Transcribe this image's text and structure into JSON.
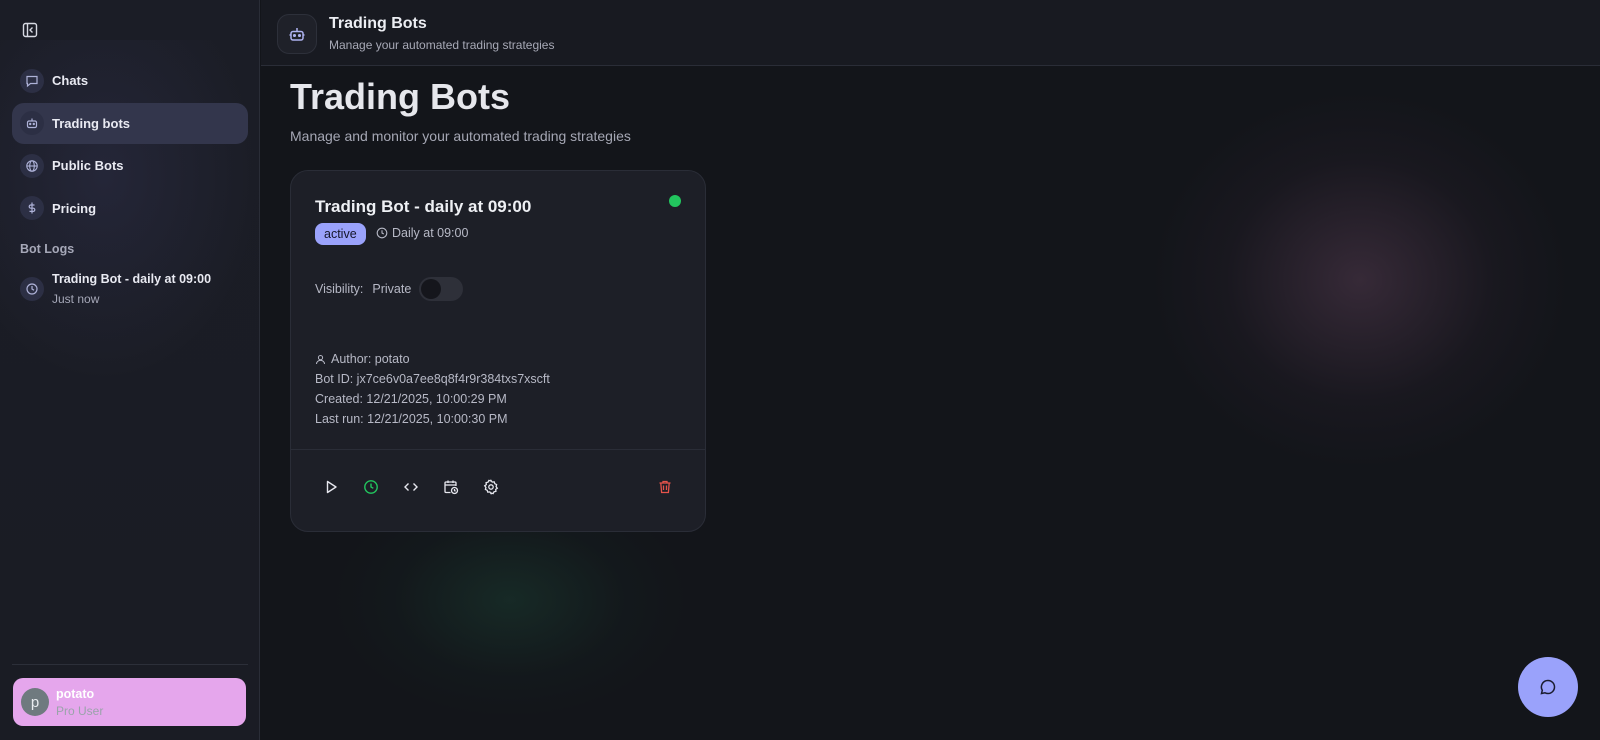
{
  "header": {
    "title": "Trading Bots",
    "subtitle": "Manage your automated trading strategies"
  },
  "sidebar": {
    "items": [
      {
        "label": "Chats",
        "icon": "chat-icon"
      },
      {
        "label": "Trading bots",
        "icon": "bot-icon",
        "active": true
      },
      {
        "label": "Public Bots",
        "icon": "globe-icon"
      },
      {
        "label": "Pricing",
        "icon": "dollar-icon"
      }
    ],
    "section_title": "Bot Logs",
    "logs": [
      {
        "title": "Trading Bot - daily at 09:00",
        "time": "Just now"
      }
    ],
    "user": {
      "initial": "p",
      "name": "potato",
      "role": "Pro User"
    }
  },
  "main": {
    "title": "Trading Bots",
    "subtitle": "Manage and monitor your automated trading strategies",
    "card": {
      "title": "Trading Bot - daily at 09:00",
      "status": "active",
      "schedule": "Daily at 09:00",
      "visibility_label": "Visibility:",
      "visibility_value": "Private",
      "visibility_on": false,
      "author": "Author: potato",
      "bot_id": "Bot ID: jx7ce6v0a7ee8q8f4r9r384txs7xscft",
      "created": "Created: 12/21/2025, 10:00:29 PM",
      "last_run": "Last run: 12/21/2025, 10:00:30 PM"
    }
  },
  "colors": {
    "accent": "#9aa2fb",
    "active_dot": "#22c55e",
    "delete": "#e5534b",
    "user_card": "#e5a6ec"
  }
}
